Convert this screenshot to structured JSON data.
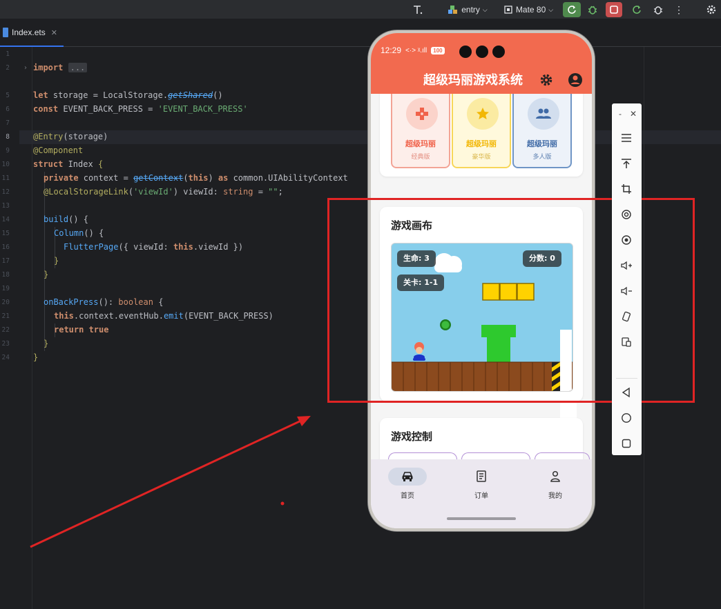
{
  "toolbar": {
    "run_config": "entry",
    "device": "Mate 80"
  },
  "tab": {
    "filename": "Index.ets"
  },
  "editor": {
    "line_numbers": [
      "1",
      "2",
      "",
      "5",
      "6",
      "7",
      "8",
      "9",
      "10",
      "11",
      "12",
      "13",
      "14",
      "15",
      "16",
      "17",
      "18",
      "19",
      "20",
      "21",
      "22",
      "23",
      "24"
    ],
    "lines": {
      "l2_kw": "import",
      "l2_fold": "...",
      "l5_a": "let",
      "l5_b": " storage = LocalStorage.",
      "l5_c": "getShared",
      "l5_d": "()",
      "l6_a": "const",
      "l6_b": " EVENT_BACK_PRESS = ",
      "l6_c": "'EVENT_BACK_PRESS'",
      "l8_a": "@Entry",
      "l8_b": "(storage)",
      "l9": "@Component",
      "l10_a": "struct",
      "l10_b": " Index ",
      "l10_c": "{",
      "l11_a": "private",
      "l11_b": " context = ",
      "l11_c": "getContext",
      "l11_d": "(",
      "l11_e": "this",
      "l11_f": ") ",
      "l11_g": "as",
      "l11_h": " common.",
      "l11_i": "UIAbilityContext",
      "l12_a": "@LocalStorageLink",
      "l12_b": "(",
      "l12_c": "'viewId'",
      "l12_d": ") viewId: ",
      "l12_e": "string",
      "l12_f": " = ",
      "l12_g": "\"\"",
      "l12_h": ";",
      "l14_a": "build",
      "l14_b": "() {",
      "l15_a": "Column",
      "l15_b": "() {",
      "l16_a": "FlutterPage",
      "l16_b": "({ viewId: ",
      "l16_c": "this",
      "l16_d": ".viewId })",
      "l17": "}",
      "l18": "}",
      "l20_a": "onBackPress",
      "l20_b": "(): ",
      "l20_c": "boolean",
      "l20_d": " {",
      "l21_a": "this",
      "l21_b": ".context.eventHub.",
      "l21_c": "emit",
      "l21_d": "(EVENT_BACK_PRESS)",
      "l22_a": "return",
      "l22_b": " true",
      "l23": "}",
      "l24": "}"
    }
  },
  "phone": {
    "status": {
      "time": "12:29",
      "sig": "<·> ᵡ.ıll",
      "battery": "100"
    },
    "app_title": "超级玛丽游戏系统",
    "versions": [
      {
        "name": "超级玛丽",
        "sub": "经典版"
      },
      {
        "name": "超级玛丽",
        "sub": "豪华版"
      },
      {
        "name": "超级玛丽",
        "sub": "多人版"
      }
    ],
    "canvas_title": "游戏画布",
    "hud": {
      "lives": "生命: 3",
      "score": "分数: 0",
      "level": "关卡: 1-1"
    },
    "control_title": "游戏控制",
    "nav": [
      {
        "label": "首页"
      },
      {
        "label": "订单"
      },
      {
        "label": "我的"
      }
    ]
  },
  "colors": {
    "appbar": "#f26a4f",
    "annotation": "#e02424",
    "sky": "#87ceeb"
  }
}
